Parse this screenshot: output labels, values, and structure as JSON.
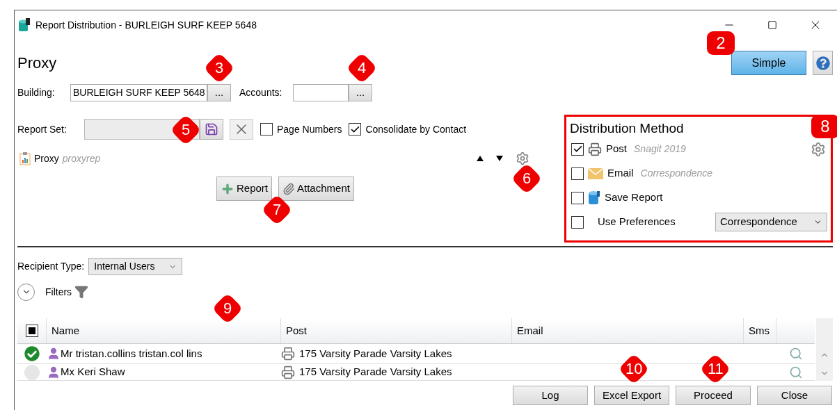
{
  "window": {
    "title": "Report Distribution - BURLEIGH SURF KEEP 5648"
  },
  "heading": "Proxy",
  "mode_button": "Simple",
  "building": {
    "label": "Building:",
    "value": "BURLEIGH SURF KEEP 5648",
    "browse": "..."
  },
  "accounts": {
    "label": "Accounts:",
    "browse": "..."
  },
  "report_set": {
    "label": "Report Set:",
    "options": [
      {
        "label": "Page Numbers",
        "checked": false
      },
      {
        "label": "Consolidate by Contact",
        "checked": true
      }
    ]
  },
  "reports": [
    {
      "name": "Proxy",
      "code": "proxyrep"
    }
  ],
  "add_buttons": [
    {
      "kind": "report",
      "label": "Report"
    },
    {
      "kind": "attachment",
      "label": "Attachment"
    }
  ],
  "distribution": {
    "title": "Distribution Method",
    "methods": [
      {
        "kind": "post",
        "label": "Post",
        "detail": "Snagit 2019",
        "checked": true
      },
      {
        "kind": "email",
        "label": "Email",
        "detail": "Correspondence",
        "checked": false
      },
      {
        "kind": "save",
        "label": "Save Report",
        "checked": false
      },
      {
        "kind": "preferences",
        "label": "Use Preferences",
        "checked": false,
        "select": "Correspondence"
      }
    ]
  },
  "recipient_type": {
    "label": "Recipient Type:",
    "value": "Internal Users"
  },
  "filters": "Filters",
  "table": {
    "indeterminate": true,
    "columns": [
      "Name",
      "Post",
      "Email",
      "Sms"
    ],
    "rows": [
      {
        "checked": true,
        "name": "Mr tristan.collins tristan.col lins",
        "post": "175 Varsity Parade Varsity Lakes"
      },
      {
        "checked": false,
        "name": "Mx Keri Shaw",
        "post": "175 Varsity Parade Varsity Lakes"
      }
    ]
  },
  "footer_buttons": [
    "Log",
    "Excel Export",
    "Proceed",
    "Close"
  ],
  "callouts": [
    {
      "label": "2",
      "kind": "square"
    },
    {
      "label": "3",
      "kind": "diamond"
    },
    {
      "label": "4",
      "kind": "diamond"
    },
    {
      "label": "5",
      "kind": "diamond"
    },
    {
      "label": "6",
      "kind": "diamond"
    },
    {
      "label": "7",
      "kind": "diamond"
    },
    {
      "label": "8",
      "kind": "square"
    },
    {
      "label": "9",
      "kind": "diamond"
    },
    {
      "label": "10",
      "kind": "diamond"
    },
    {
      "label": "11",
      "kind": "diamond"
    }
  ]
}
